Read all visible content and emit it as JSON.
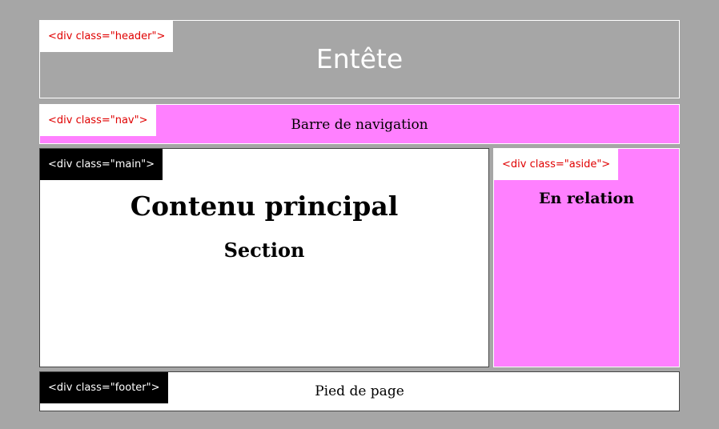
{
  "colors": {
    "page_background": "#a6a6a6",
    "header_background": "#a6a6a6",
    "nav_background": "#ff80ff",
    "main_background": "#ffffff",
    "aside_background": "#ff80ff",
    "footer_background": "#ffffff",
    "tag_light_text": "#e00000",
    "tag_dark_background": "#000000"
  },
  "header": {
    "tag": "<div class=\"header\">",
    "title": "Entête"
  },
  "nav": {
    "tag": "<div class=\"nav\">",
    "text": "Barre de navigation"
  },
  "main": {
    "tag": "<div class=\"main\">",
    "title": "Contenu principal",
    "section": "Section"
  },
  "aside": {
    "tag": "<div class=\"aside\">",
    "title": "En relation"
  },
  "footer": {
    "tag": "<div class=\"footer\">",
    "text": "Pied de page"
  }
}
